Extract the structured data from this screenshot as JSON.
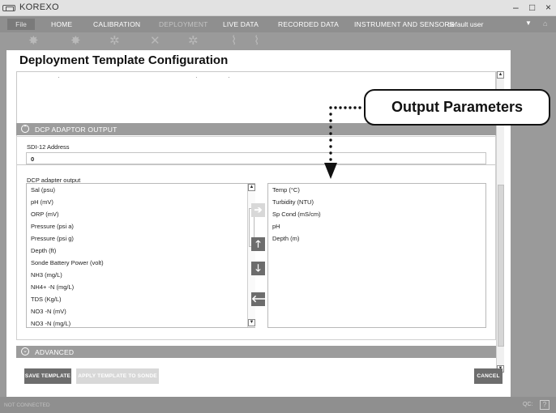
{
  "window": {
    "title": "KOREXO",
    "controls": [
      "–",
      "□",
      "×"
    ]
  },
  "menu": {
    "file": "File",
    "items": [
      {
        "label": "HOME",
        "active": true
      },
      {
        "label": "CALIBRATION",
        "active": true
      },
      {
        "label": "DEPLOYMENT",
        "active": false
      },
      {
        "label": "LIVE DATA",
        "active": true
      },
      {
        "label": "RECORDED DATA",
        "active": true
      },
      {
        "label": "INSTRUMENT AND SENSORS",
        "active": true
      }
    ],
    "user": "default user"
  },
  "toolbar": {
    "icons": [
      "gear-icon",
      "gear-icon",
      "wrench-gear-icon",
      "tools-icon",
      "gear-settings-icon",
      "chart-gear-icon",
      "chart-gear-icon"
    ]
  },
  "dialog": {
    "title": "Deployment Template Configuration",
    "dcp_section": {
      "header": "DCP ADAPTOR OUTPUT",
      "sdi_label": "SDI-12 Address",
      "sdi_value": "0",
      "output_label": "DCP adapter output",
      "available": [
        "Sal (psu)",
        "pH (mV)",
        "ORP (mV)",
        "Pressure (psi a)",
        "Pressure (psi g)",
        "Depth (ft)",
        "Sonde Battery Power (volt)",
        "NH3 (mg/L)",
        "NH4+ -N (mg/L)",
        "TDS (Kg/L)",
        "NO3 -N (mV)",
        "NO3 -N (mg/L)"
      ],
      "selected": [
        "Temp (°C)",
        "Turbidity (NTU)",
        "Sp Cond (mS/cm)",
        "pH",
        "Depth (m)"
      ]
    },
    "advanced_section": {
      "header": "ADVANCED"
    },
    "buttons": {
      "save": "SAVE TEMPLATE",
      "apply": "APPLY TEMPLATE TO SONDE",
      "cancel": "CANCEL"
    }
  },
  "status": {
    "connection": "NOT CONNECTED",
    "qc": "QC:",
    "help": "?"
  },
  "callout": {
    "text": "Output Parameters"
  },
  "colors": {
    "menu_bg": "#8f8f8f",
    "section_bg": "#9c9c9c",
    "button_dark": "#6d6d6d",
    "button_light": "#d8d8d8"
  }
}
